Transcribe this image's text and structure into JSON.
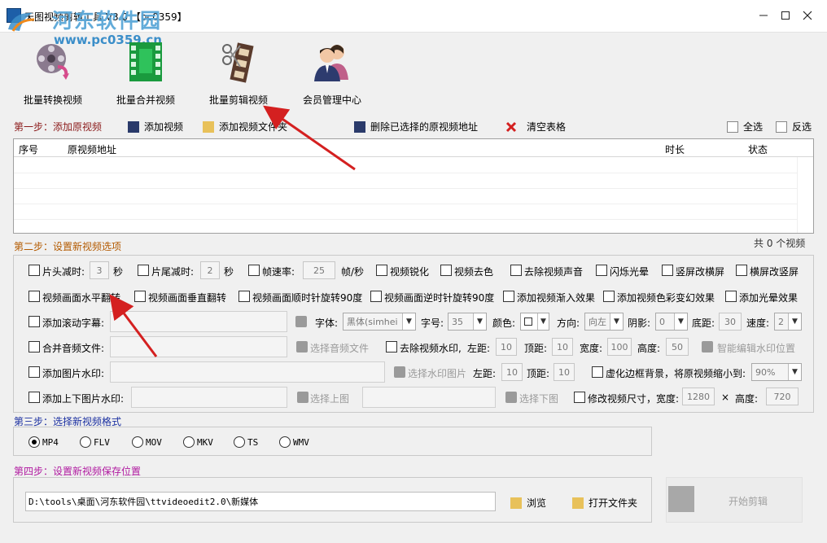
{
  "window": {
    "title": "天图视频剪辑工具 V3.0 【pc0359】",
    "watermark_title": "河东软件园",
    "watermark_url": "www.pc0359.cn"
  },
  "toolbar": {
    "buttons": [
      {
        "label": "批量转换视频",
        "icon": "film-reel-icon"
      },
      {
        "label": "批量合并视频",
        "icon": "film-strip-icon"
      },
      {
        "label": "批量剪辑视频",
        "icon": "scissors-film-icon"
      },
      {
        "label": "会员管理中心",
        "icon": "members-icon"
      }
    ]
  },
  "step1": {
    "label": "第一步：添加原视频",
    "add_video": "添加视频",
    "add_folder": "添加视频文件夹",
    "delete_selected": "删除已选择的原视频地址",
    "clear_table": "清空表格",
    "select_all": "全选",
    "invert": "反选",
    "columns": [
      "序号",
      "原视频地址",
      "时长",
      "状态"
    ],
    "count_text": "共 0 个视频"
  },
  "step2": {
    "label": "第二步：设置新视频选项",
    "row1": {
      "head_cut": "片头减时:",
      "head_cut_value": "3",
      "sec1": "秒",
      "tail_cut": "片尾减时:",
      "tail_cut_value": "2",
      "sec2": "秒",
      "fps": "帧速率:",
      "fps_value": "25",
      "fps_unit": "帧/秒",
      "sharpen": "视频锐化",
      "decolor": "视频去色",
      "mute": "去除视频声音",
      "flash": "闪烁光晕",
      "v2h": "竖屏改横屏",
      "h2v": "横屏改竖屏"
    },
    "row2": {
      "hflip": "视频画面水平翻转",
      "vflip": "视频画面垂直翻转",
      "rot_cw": "视频画面顺时针旋转90度",
      "rot_ccw": "视频画面逆时针旋转90度",
      "fade": "添加视频渐入效果",
      "color_fx": "添加视频色彩变幻效果",
      "halo": "添加光晕效果"
    },
    "row3": {
      "scroll_sub": "添加滚动字幕:",
      "font": "字体:",
      "font_value": "黑体(simhei",
      "size": "字号:",
      "size_value": "35",
      "color": "颜色:",
      "direction": "方向:",
      "direction_value": "向左",
      "shadow": "阴影:",
      "shadow_value": "0",
      "bottom": "底距:",
      "bottom_value": "30",
      "speed": "速度:",
      "speed_value": "2"
    },
    "row4": {
      "merge_audio": "合并音频文件:",
      "choose_audio": "选择音频文件",
      "remove_wm": "去除视频水印,",
      "left": "左距:",
      "left_value": "10",
      "top": "顶距:",
      "top_value": "10",
      "width": "宽度:",
      "width_value": "100",
      "height": "高度:",
      "height_value": "50",
      "smart_edit": "智能编辑水印位置"
    },
    "row5": {
      "img_wm": "添加图片水印:",
      "choose_wm_img": "选择水印图片",
      "left": "左距:",
      "left_value": "10",
      "top": "顶距:",
      "top_value": "10",
      "blur_bg": "虚化边框背景，将原视频缩小到:",
      "scale_value": "90%"
    },
    "row6": {
      "tb_img_wm": "添加上下图片水印:",
      "choose_top": "选择上图",
      "choose_bottom": "选择下图",
      "resize": "修改视频尺寸，宽度:",
      "width_value": "1280",
      "times": "×",
      "height": "高度:",
      "height_value": "720"
    }
  },
  "step3": {
    "label": "第三步：选择新视频格式",
    "formats": [
      "MP4",
      "FLV",
      "MOV",
      "MKV",
      "TS",
      "WMV"
    ],
    "selected": "MP4"
  },
  "step4": {
    "label": "第四步：设置新视频保存位置",
    "path": "D:\\tools\\桌面\\河东软件园\\ttvideoedit2.0\\新媒体",
    "browse": "浏览",
    "open_folder": "打开文件夹",
    "start": "开始剪辑"
  },
  "colors": {
    "step1": "#8b1a1a",
    "step2": "#b35a00",
    "step3": "#1a2fa0",
    "step4": "#b01aa0",
    "arrow": "#d42020",
    "watermark": "#5aa7d8"
  }
}
